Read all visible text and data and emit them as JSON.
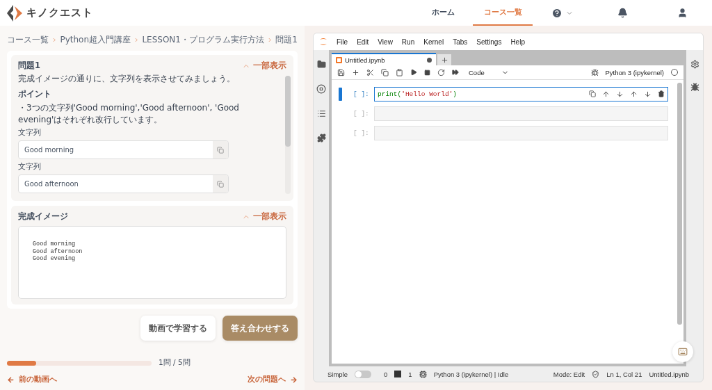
{
  "header": {
    "logo_text": "キノクエスト",
    "nav": [
      {
        "label": "ホーム",
        "selected": false
      },
      {
        "label": "コース一覧",
        "selected": true
      }
    ]
  },
  "breadcrumbs": [
    "コース一覧",
    "Python超入門講座",
    "LESSON1・プログラム実行方法",
    "問題1"
  ],
  "problem": {
    "title": "問題1",
    "toggle": "一部表示",
    "description": "完成イメージの通りに、文字列を表示させてみましょう。",
    "point_title": "ポイント",
    "point_text": "・3つの文字列'Good morning','Good afternoon', 'Good evening'はそれぞれ改行しています。",
    "fields": [
      {
        "label": "文字列",
        "value": "Good morning"
      },
      {
        "label": "文字列",
        "value": "Good afternoon"
      }
    ]
  },
  "image": {
    "title": "完成イメージ",
    "toggle": "一部表示",
    "output": [
      "Good morning",
      "Good afternoon",
      "Good evening"
    ]
  },
  "buttons": [
    {
      "label": "動画で学習する",
      "kind": "secondary"
    },
    {
      "label": "答え合わせする",
      "kind": "primary"
    }
  ],
  "progress": {
    "level": 0.2,
    "label": "1問 / 5問"
  },
  "links": {
    "prev": "前の動画へ",
    "next": "次の問題へ"
  },
  "jupyter": {
    "menu": [
      "File",
      "Edit",
      "View",
      "Run",
      "Kernel",
      "Tabs",
      "Settings",
      "Help"
    ],
    "tab": {
      "title": "Untitled.ipynb",
      "modified": true
    },
    "cell_type": "Code",
    "kernel": "Python 3 (ipykernel)",
    "cells": [
      {
        "prompt": "[ ]:",
        "active": true,
        "tokens": [
          {
            "text": "print(",
            "kind": "builtin"
          },
          {
            "text": "'Hello World'",
            "kind": "string"
          },
          {
            "text": ")",
            "kind": "builtin"
          }
        ]
      },
      {
        "prompt": "[ ]:",
        "active": false
      },
      {
        "prompt": "[ ]:",
        "active": false
      }
    ],
    "status": {
      "simple_label": "Simple",
      "simple_on": false,
      "terminals": "0",
      "kernels": "1",
      "kernel_status": "Python 3 (ipykernel) | Idle",
      "mode": "Mode: Edit",
      "position": "Ln 1, Col 21",
      "file": "Untitled.ipynb"
    }
  }
}
